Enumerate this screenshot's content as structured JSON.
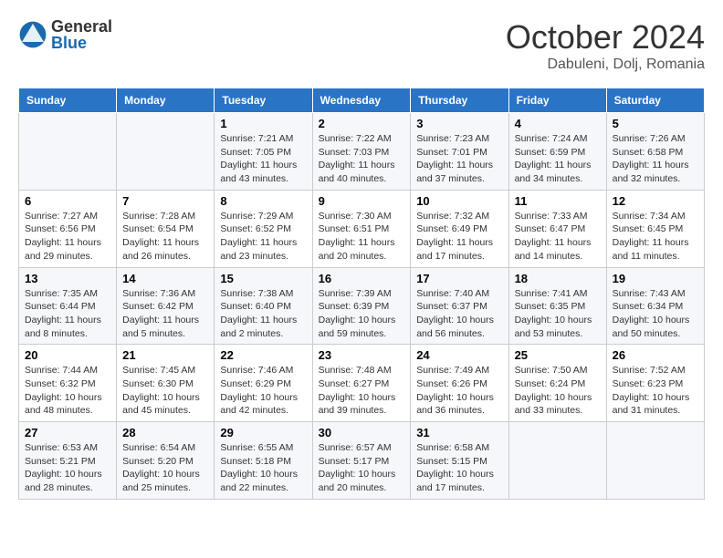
{
  "logo": {
    "general": "General",
    "blue": "Blue"
  },
  "title": "October 2024",
  "subtitle": "Dabuleni, Dolj, Romania",
  "days_of_week": [
    "Sunday",
    "Monday",
    "Tuesday",
    "Wednesday",
    "Thursday",
    "Friday",
    "Saturday"
  ],
  "weeks": [
    [
      {
        "day": "",
        "info": ""
      },
      {
        "day": "",
        "info": ""
      },
      {
        "day": "1",
        "info": "Sunrise: 7:21 AM\nSunset: 7:05 PM\nDaylight: 11 hours and 43 minutes."
      },
      {
        "day": "2",
        "info": "Sunrise: 7:22 AM\nSunset: 7:03 PM\nDaylight: 11 hours and 40 minutes."
      },
      {
        "day": "3",
        "info": "Sunrise: 7:23 AM\nSunset: 7:01 PM\nDaylight: 11 hours and 37 minutes."
      },
      {
        "day": "4",
        "info": "Sunrise: 7:24 AM\nSunset: 6:59 PM\nDaylight: 11 hours and 34 minutes."
      },
      {
        "day": "5",
        "info": "Sunrise: 7:26 AM\nSunset: 6:58 PM\nDaylight: 11 hours and 32 minutes."
      }
    ],
    [
      {
        "day": "6",
        "info": "Sunrise: 7:27 AM\nSunset: 6:56 PM\nDaylight: 11 hours and 29 minutes."
      },
      {
        "day": "7",
        "info": "Sunrise: 7:28 AM\nSunset: 6:54 PM\nDaylight: 11 hours and 26 minutes."
      },
      {
        "day": "8",
        "info": "Sunrise: 7:29 AM\nSunset: 6:52 PM\nDaylight: 11 hours and 23 minutes."
      },
      {
        "day": "9",
        "info": "Sunrise: 7:30 AM\nSunset: 6:51 PM\nDaylight: 11 hours and 20 minutes."
      },
      {
        "day": "10",
        "info": "Sunrise: 7:32 AM\nSunset: 6:49 PM\nDaylight: 11 hours and 17 minutes."
      },
      {
        "day": "11",
        "info": "Sunrise: 7:33 AM\nSunset: 6:47 PM\nDaylight: 11 hours and 14 minutes."
      },
      {
        "day": "12",
        "info": "Sunrise: 7:34 AM\nSunset: 6:45 PM\nDaylight: 11 hours and 11 minutes."
      }
    ],
    [
      {
        "day": "13",
        "info": "Sunrise: 7:35 AM\nSunset: 6:44 PM\nDaylight: 11 hours and 8 minutes."
      },
      {
        "day": "14",
        "info": "Sunrise: 7:36 AM\nSunset: 6:42 PM\nDaylight: 11 hours and 5 minutes."
      },
      {
        "day": "15",
        "info": "Sunrise: 7:38 AM\nSunset: 6:40 PM\nDaylight: 11 hours and 2 minutes."
      },
      {
        "day": "16",
        "info": "Sunrise: 7:39 AM\nSunset: 6:39 PM\nDaylight: 10 hours and 59 minutes."
      },
      {
        "day": "17",
        "info": "Sunrise: 7:40 AM\nSunset: 6:37 PM\nDaylight: 10 hours and 56 minutes."
      },
      {
        "day": "18",
        "info": "Sunrise: 7:41 AM\nSunset: 6:35 PM\nDaylight: 10 hours and 53 minutes."
      },
      {
        "day": "19",
        "info": "Sunrise: 7:43 AM\nSunset: 6:34 PM\nDaylight: 10 hours and 50 minutes."
      }
    ],
    [
      {
        "day": "20",
        "info": "Sunrise: 7:44 AM\nSunset: 6:32 PM\nDaylight: 10 hours and 48 minutes."
      },
      {
        "day": "21",
        "info": "Sunrise: 7:45 AM\nSunset: 6:30 PM\nDaylight: 10 hours and 45 minutes."
      },
      {
        "day": "22",
        "info": "Sunrise: 7:46 AM\nSunset: 6:29 PM\nDaylight: 10 hours and 42 minutes."
      },
      {
        "day": "23",
        "info": "Sunrise: 7:48 AM\nSunset: 6:27 PM\nDaylight: 10 hours and 39 minutes."
      },
      {
        "day": "24",
        "info": "Sunrise: 7:49 AM\nSunset: 6:26 PM\nDaylight: 10 hours and 36 minutes."
      },
      {
        "day": "25",
        "info": "Sunrise: 7:50 AM\nSunset: 6:24 PM\nDaylight: 10 hours and 33 minutes."
      },
      {
        "day": "26",
        "info": "Sunrise: 7:52 AM\nSunset: 6:23 PM\nDaylight: 10 hours and 31 minutes."
      }
    ],
    [
      {
        "day": "27",
        "info": "Sunrise: 6:53 AM\nSunset: 5:21 PM\nDaylight: 10 hours and 28 minutes."
      },
      {
        "day": "28",
        "info": "Sunrise: 6:54 AM\nSunset: 5:20 PM\nDaylight: 10 hours and 25 minutes."
      },
      {
        "day": "29",
        "info": "Sunrise: 6:55 AM\nSunset: 5:18 PM\nDaylight: 10 hours and 22 minutes."
      },
      {
        "day": "30",
        "info": "Sunrise: 6:57 AM\nSunset: 5:17 PM\nDaylight: 10 hours and 20 minutes."
      },
      {
        "day": "31",
        "info": "Sunrise: 6:58 AM\nSunset: 5:15 PM\nDaylight: 10 hours and 17 minutes."
      },
      {
        "day": "",
        "info": ""
      },
      {
        "day": "",
        "info": ""
      }
    ]
  ]
}
